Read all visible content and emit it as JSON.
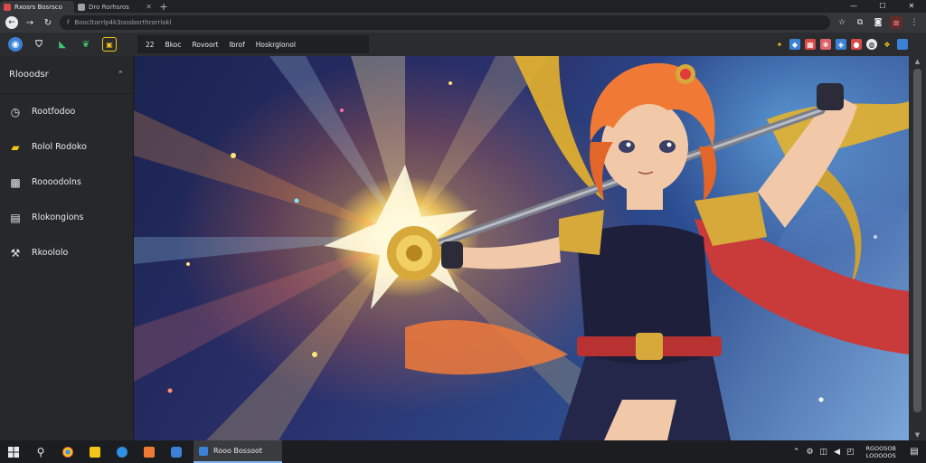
{
  "browser": {
    "tabs": [
      {
        "title": "Rxosrs Bosrsco",
        "active": true
      },
      {
        "title": "Dro Rorhsros",
        "active": false
      }
    ],
    "new_tab_label": "+",
    "window_controls": {
      "minimize": "—",
      "maximize": "☐",
      "close": "✕"
    },
    "address": "Boocltorrlp4k3oosborthrorrlokl",
    "address_prefix": "f"
  },
  "bookmarks": {
    "group_items": [
      "Bkoc",
      "Rovoort",
      "Ibrof",
      "Hoskrglonol"
    ],
    "group_prefix": "22"
  },
  "sidebar": {
    "title": "Rlooodsr",
    "items": [
      {
        "label": "Rootfodoo",
        "icon": "clock-icon"
      },
      {
        "label": "Rolol Rodoko",
        "icon": "folder-icon"
      },
      {
        "label": "Roooodolns",
        "icon": "image-icon"
      },
      {
        "label": "Rlokongions",
        "icon": "chat-icon"
      },
      {
        "label": "Rkoololo",
        "icon": "wrench-icon"
      }
    ]
  },
  "taskbar": {
    "active_window": "Rooo Bossoot",
    "clock_time": "RGOOSOB",
    "clock_date": "LOOOOOS"
  },
  "colors": {
    "chrome_dark": "#202124",
    "toolbar": "#35363a",
    "sidebar": "#26282b",
    "accent_blue": "#7fb3f5"
  }
}
